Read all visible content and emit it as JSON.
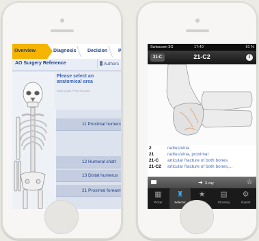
{
  "left_screen": {
    "breadcrumb": [
      "Overview",
      "Diagnosis",
      "Decision",
      "P"
    ],
    "header_title": "AO Surgery Reference",
    "authors_label": "Authors",
    "prompt_title": "Please select an anatomical area",
    "prompt_hint": "Drag to pan, Pinch to zoom",
    "regions": [
      "11 Proximal humerus",
      "12 Humeral shaft",
      "13 Distal humerus",
      "21 Proximal forearm"
    ]
  },
  "right_screen": {
    "status": {
      "carrier": "Swisscom  3G",
      "time": "17:40",
      "battery": "61 %"
    },
    "back_label": "21-C",
    "title": "21-C2",
    "legend": [
      {
        "code": "2",
        "text": "radius/ulna"
      },
      {
        "code": "21",
        "text": "radius/ulna, proximal"
      },
      {
        "code": "21-C",
        "text": "articular fracture of both bones"
      },
      {
        "code": "21-C2",
        "text": "articular fracture of both bones,..."
      }
    ],
    "toolbar_xray_label": "X-ray",
    "tabs": [
      {
        "label": "Picker",
        "icon": "picker-icon"
      },
      {
        "label": "Selector",
        "icon": "selector-icon"
      },
      {
        "label": "Cases",
        "icon": "star-icon"
      },
      {
        "label": "Glossary",
        "icon": "book-icon"
      },
      {
        "label": "Imprint",
        "icon": "gears-icon"
      }
    ]
  },
  "colors": {
    "accent_orange": "#f4b400",
    "link_blue": "#4a6fb5",
    "tab_selected_blue": "#39a9ff"
  }
}
